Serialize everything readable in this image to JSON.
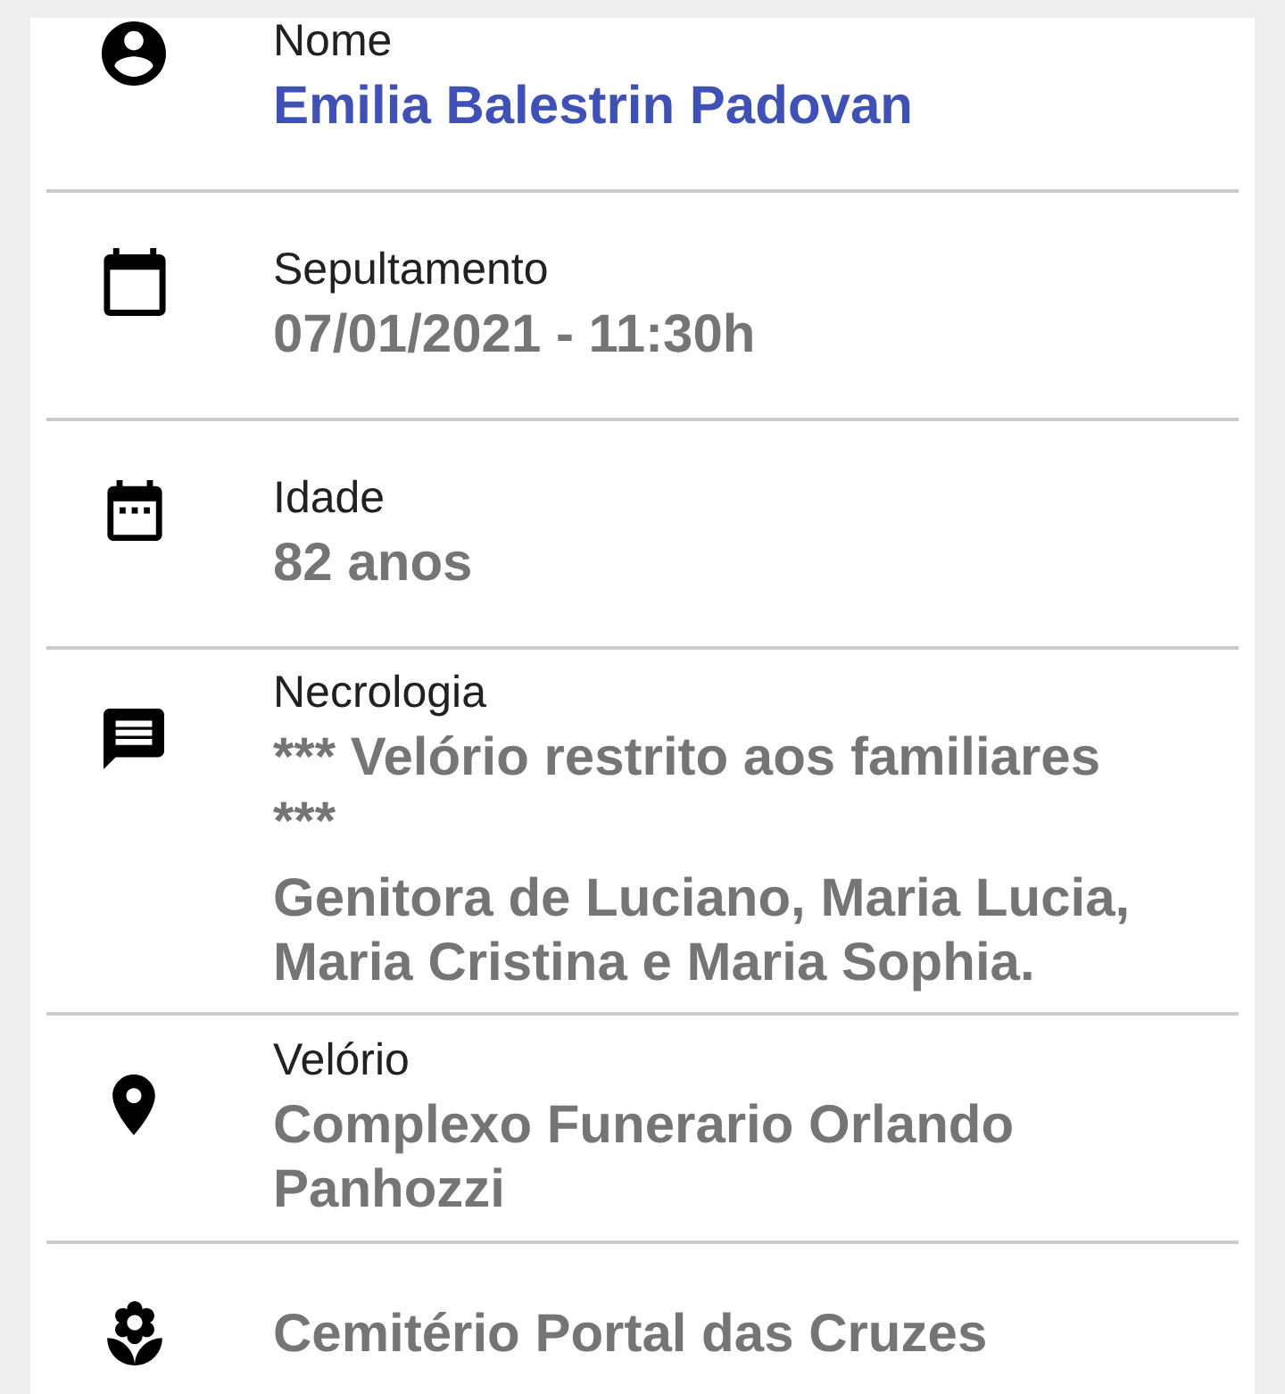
{
  "fields": [
    {
      "kind": "name",
      "label": "Nome",
      "paragraphs": [
        "Emilia Balestrin Padovan"
      ]
    },
    {
      "kind": "burial",
      "label": "Sepultamento",
      "paragraphs": [
        "07/01/2021 - 11:30h"
      ]
    },
    {
      "kind": "age",
      "label": "Idade",
      "paragraphs": [
        "82 anos"
      ]
    },
    {
      "kind": "obituary",
      "label": "Necrologia",
      "paragraphs": [
        "*** Velório restrito aos familiares ***",
        "Genitora de Luciano, Maria Lucia, Maria Cristina e Maria Sophia."
      ]
    },
    {
      "kind": "wake",
      "label": "Velório",
      "paragraphs": [
        "Complexo Funerario Orlando Panhozzi"
      ]
    },
    {
      "kind": "cemetery",
      "paragraphs": [
        "Cemitério Portal das Cruzes"
      ]
    }
  ]
}
